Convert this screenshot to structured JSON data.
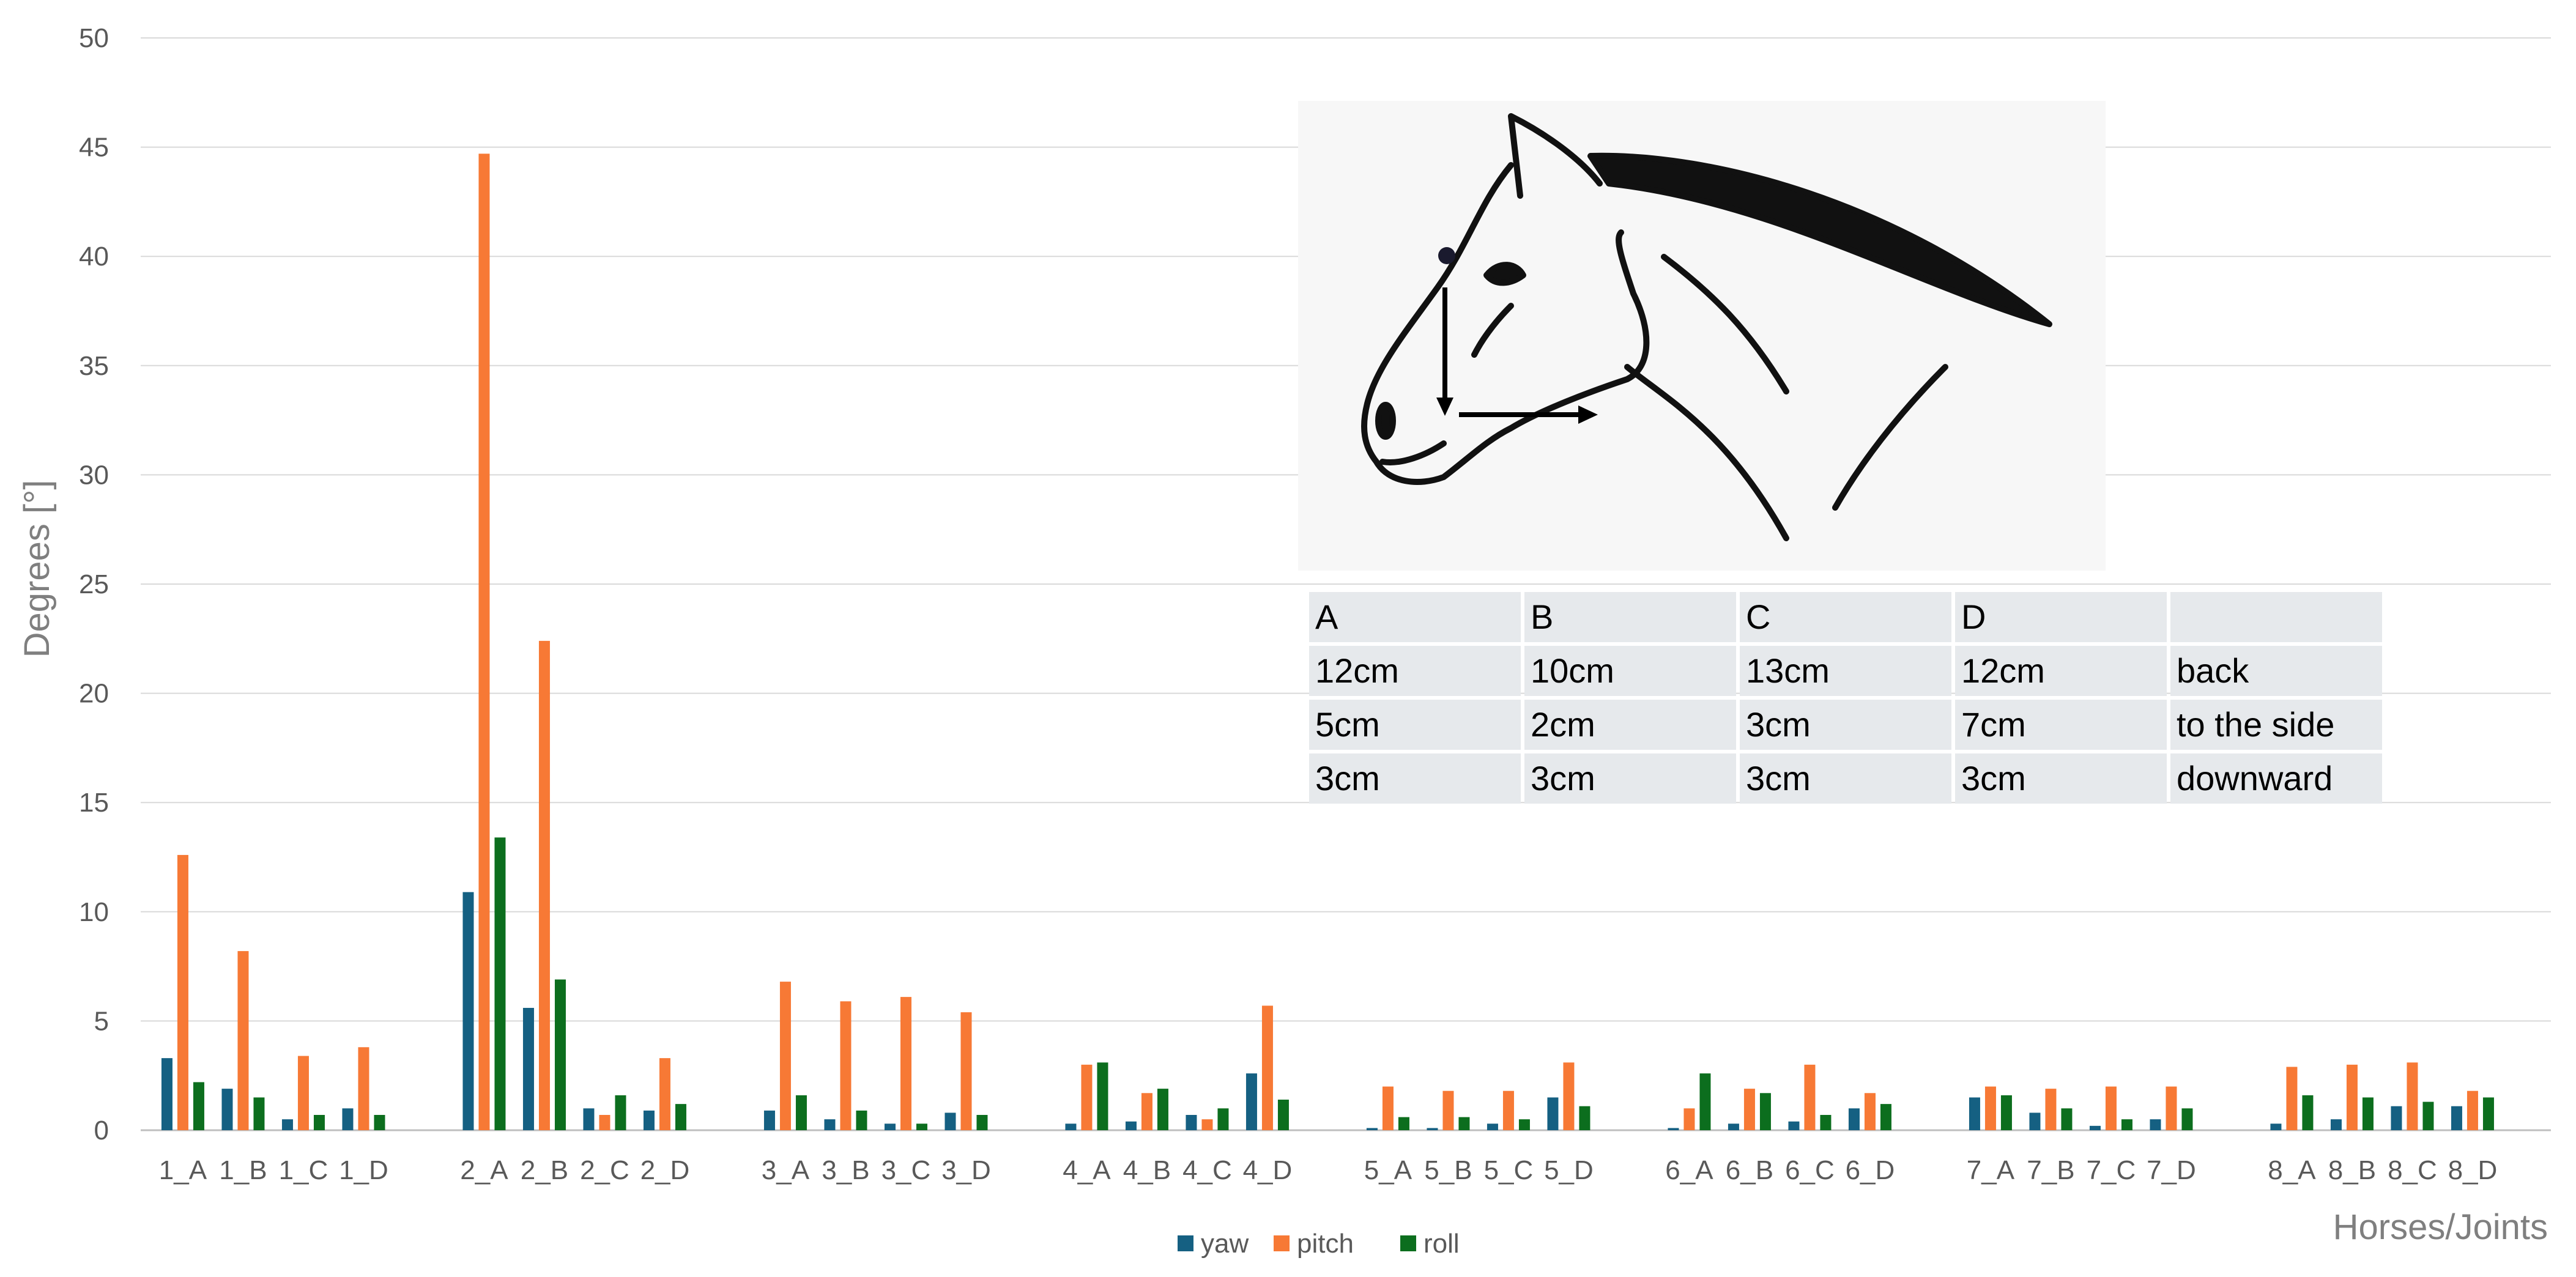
{
  "chart_data": {
    "type": "bar",
    "title": "",
    "ylabel": "Degrees [°]",
    "xlabel": "Horses/Joints",
    "ylim": [
      0,
      50
    ],
    "yticks": [
      0,
      5,
      10,
      15,
      20,
      25,
      30,
      35,
      40,
      45,
      50
    ],
    "grid": true,
    "legend_position": "bottom",
    "groups": [
      [
        "1_A",
        "1_B",
        "1_C",
        "1_D"
      ],
      [
        "2_A",
        "2_B",
        "2_C",
        "2_D"
      ],
      [
        "3_A",
        "3_B",
        "3_C",
        "3_D"
      ],
      [
        "4_A",
        "4_B",
        "4_C",
        "4_D"
      ],
      [
        "5_A",
        "5_B",
        "5_C",
        "5_D"
      ],
      [
        "6_A",
        "6_B",
        "6_C",
        "6_D"
      ],
      [
        "7_A",
        "7_B",
        "7_C",
        "7_D"
      ],
      [
        "8_A",
        "8_B",
        "8_C",
        "8_D"
      ]
    ],
    "series": [
      {
        "name": "yaw",
        "color": "#156082",
        "values": [
          3.3,
          1.9,
          0.5,
          1.0,
          10.9,
          5.6,
          1.0,
          0.9,
          0.9,
          0.5,
          0.3,
          0.8,
          0.3,
          0.4,
          0.7,
          2.6,
          0.1,
          0.1,
          0.3,
          1.5,
          0.1,
          0.3,
          0.4,
          1.0,
          1.5,
          0.8,
          0.2,
          0.5,
          0.3,
          0.5,
          1.1,
          1.1
        ]
      },
      {
        "name": "pitch",
        "color": "#F77935",
        "values": [
          12.6,
          8.2,
          3.4,
          3.8,
          44.7,
          22.4,
          0.7,
          3.3,
          6.8,
          5.9,
          6.1,
          5.4,
          3.0,
          1.7,
          0.5,
          5.7,
          2.0,
          1.8,
          1.8,
          3.1,
          1.0,
          1.9,
          3.0,
          1.7,
          2.0,
          1.9,
          2.0,
          2.0,
          2.9,
          3.0,
          3.1,
          1.8
        ]
      },
      {
        "name": "roll",
        "color": "#0C6E1E",
        "values": [
          2.2,
          1.5,
          0.7,
          0.7,
          13.4,
          6.9,
          1.6,
          1.2,
          1.6,
          0.9,
          0.3,
          0.7,
          3.1,
          1.9,
          1.0,
          1.4,
          0.6,
          0.6,
          0.5,
          1.1,
          2.6,
          1.7,
          0.7,
          1.2,
          1.6,
          1.0,
          0.5,
          1.0,
          1.6,
          1.5,
          1.3,
          1.5
        ]
      }
    ]
  },
  "inset": {
    "image": "horse-head-drawing",
    "table": {
      "header": [
        "A",
        "B",
        "C",
        "D",
        ""
      ],
      "rows": [
        [
          "12cm",
          "10cm",
          "13cm",
          "12cm",
          "back"
        ],
        [
          "5cm",
          "2cm",
          "3cm",
          "7cm",
          "to the side"
        ],
        [
          "3cm",
          "3cm",
          "3cm",
          "3cm",
          "downward"
        ]
      ]
    }
  }
}
